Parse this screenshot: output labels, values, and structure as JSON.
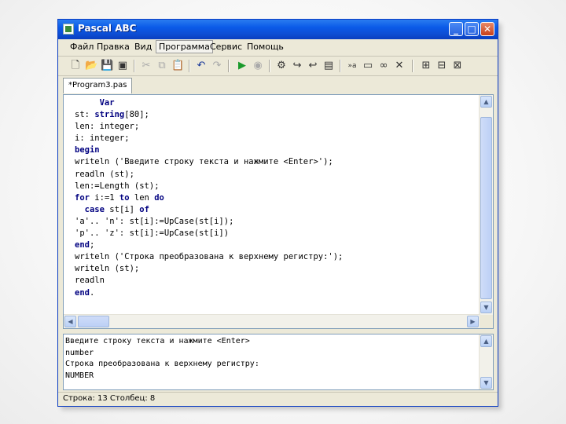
{
  "window": {
    "title": "Pascal ABC",
    "minimize_glyph": "_",
    "maximize_glyph": "□",
    "close_glyph": "✕"
  },
  "menu": {
    "items": [
      "Файл",
      "Правка",
      "Вид",
      "Программа",
      "Сервис",
      "Помощь"
    ],
    "active": "Программа"
  },
  "toolbar": {
    "icons": [
      "new-file-icon",
      "open-folder-icon",
      "save-icon",
      "save-all-icon",
      "cut-icon",
      "copy-icon",
      "paste-icon",
      "undo-icon",
      "redo-icon",
      "run-icon",
      "stop-icon",
      "compile-icon",
      "step-into-icon",
      "step-over-icon",
      "watch-icon",
      "variables-icon",
      "window-icon",
      "debug-icon",
      "close-x-icon",
      "panel1-icon",
      "panel2-icon",
      "panel3-icon"
    ]
  },
  "tabs": [
    {
      "label": "*Program3.pas"
    }
  ],
  "editor": {
    "lines": [
      "     Var",
      "st: string[80];",
      "len: integer;",
      "i: integer;",
      "begin",
      "writeln ('Введите строку текста и нажмите <Enter>');",
      "readln (st);",
      "len:=Length (st);",
      "for i:=1 to len do",
      "  case st[i] of",
      "'a'.. 'n': st[i]:=UpCase(st[i]);",
      "'p'.. 'z': st[i]:=UpCase(st[i])",
      "end;",
      "writeln ('Строка преобразована к верхнему регистру:');",
      "writeln (st);",
      "readln",
      "end."
    ]
  },
  "output": {
    "lines": [
      "Введите строку текста и нажмите <Enter>",
      "number",
      "Строка преобразована к верхнему регистру:",
      "NUMBER"
    ]
  },
  "status": {
    "text": "Строка: 13    Столбец: 8"
  },
  "colors": {
    "titlebar": "#0a5ae8",
    "keyword": "#000080",
    "window_bg": "#ece9d8"
  }
}
